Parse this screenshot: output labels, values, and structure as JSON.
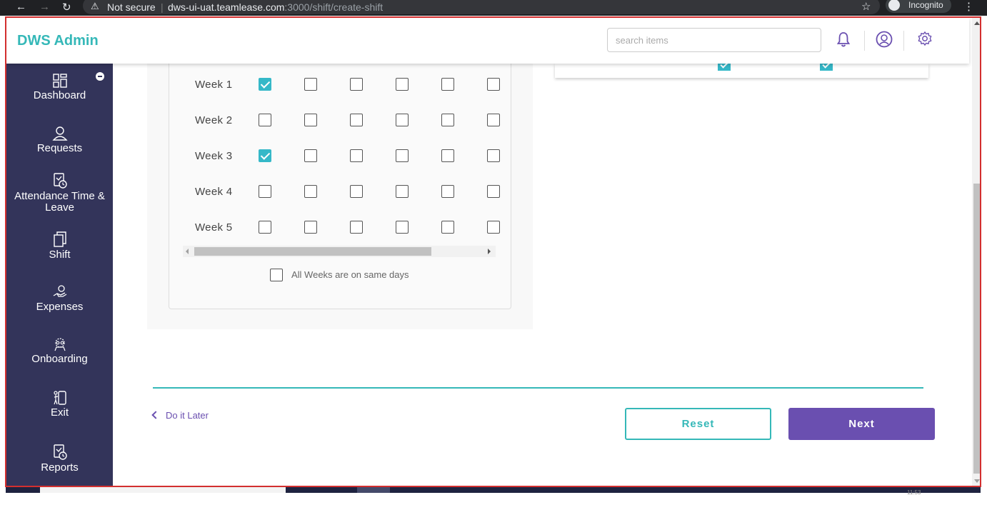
{
  "browser": {
    "security_label": "Not secure",
    "host": "dws-ui-uat.teamlease.com",
    "path": ":3000/shift/create-shift",
    "incognito_label": "Incognito"
  },
  "header": {
    "brand": "DWS Admin",
    "search_placeholder": "search items"
  },
  "sidebar": {
    "items": [
      {
        "label": "Dashboard",
        "icon": "dashboard-icon"
      },
      {
        "label": "Requests",
        "icon": "user-icon"
      },
      {
        "label": "Attendance Time & Leave",
        "icon": "calendar-clock-icon"
      },
      {
        "label": "Shift",
        "icon": "copy-icon"
      },
      {
        "label": "Expenses",
        "icon": "hand-coin-icon"
      },
      {
        "label": "Onboarding",
        "icon": "people-gear-icon"
      },
      {
        "label": "Exit",
        "icon": "exit-door-icon"
      },
      {
        "label": "Reports",
        "icon": "report-clock-icon"
      }
    ]
  },
  "weeks": [
    {
      "label": "Week 1",
      "checked": [
        true,
        false,
        false,
        false,
        false,
        false
      ]
    },
    {
      "label": "Week 2",
      "checked": [
        false,
        false,
        false,
        false,
        false,
        false
      ]
    },
    {
      "label": "Week 3",
      "checked": [
        true,
        false,
        false,
        false,
        false,
        false
      ]
    },
    {
      "label": "Week 4",
      "checked": [
        false,
        false,
        false,
        false,
        false,
        false
      ]
    },
    {
      "label": "Week 5",
      "checked": [
        false,
        false,
        false,
        false,
        false,
        false
      ]
    }
  ],
  "all_weeks_label": "All Weeks are on same days",
  "all_weeks_checked": false,
  "footer": {
    "do_it_later": "Do it Later",
    "reset_label": "Reset",
    "next_label": "Next"
  },
  "taskbar": {
    "clock": "11:53"
  },
  "colors": {
    "accent_teal": "#35b8b8",
    "primary_purple": "#6a4fb0",
    "sidebar_bg": "#33345a"
  }
}
